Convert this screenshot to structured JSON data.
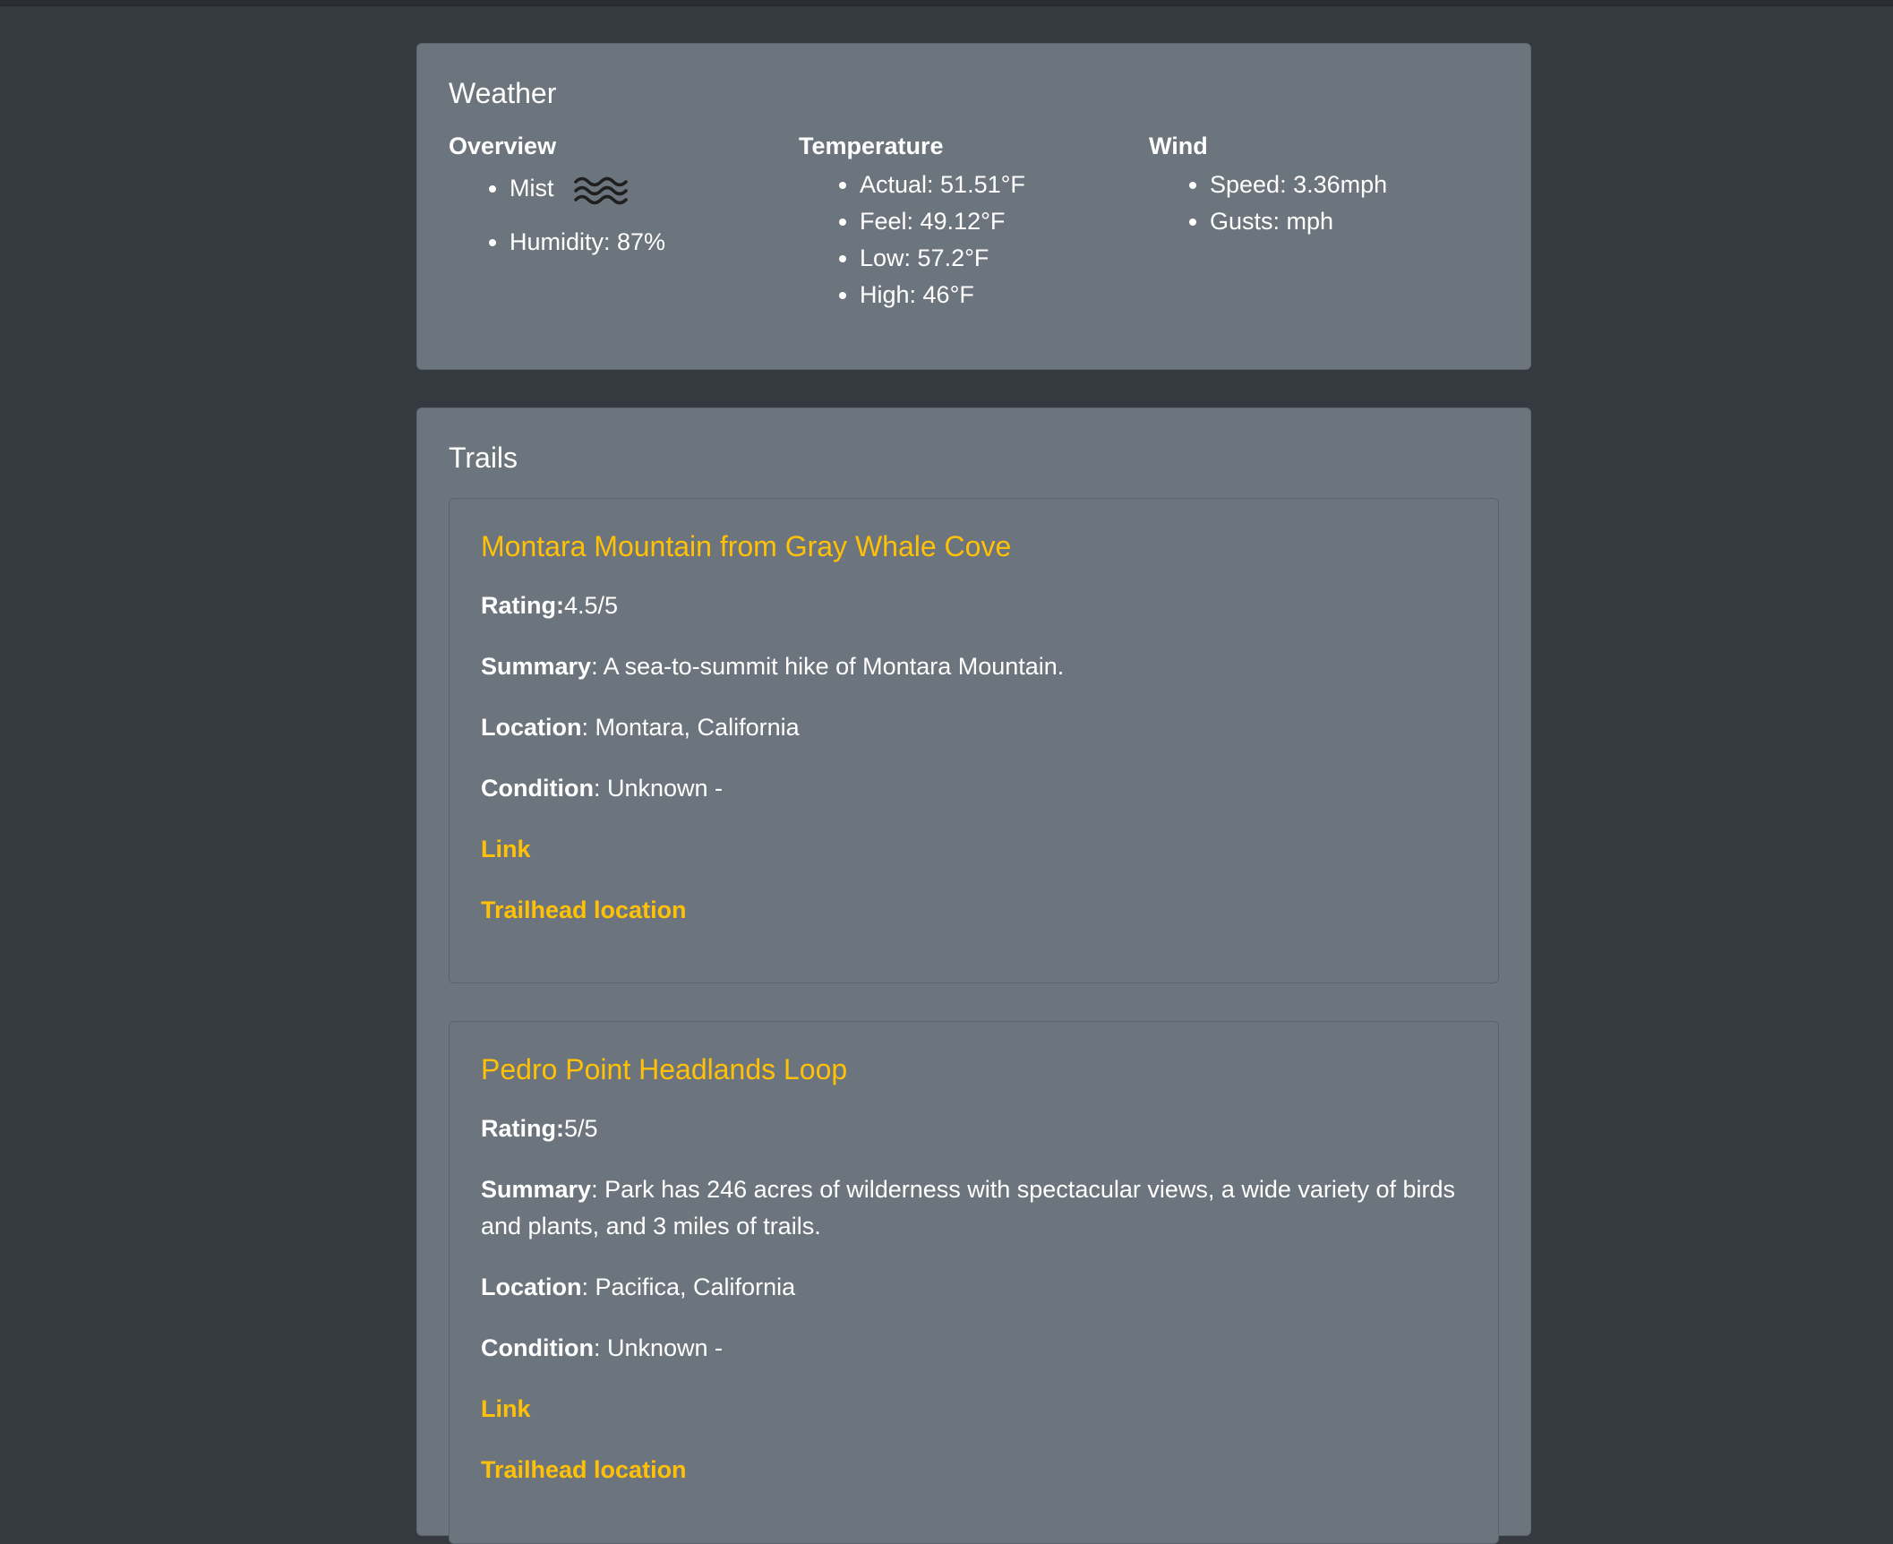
{
  "weather": {
    "title": "Weather",
    "overview": {
      "heading": "Overview",
      "condition": "Mist",
      "condition_icon": "mist-icon",
      "humidity": "Humidity: 87%"
    },
    "temperature": {
      "heading": "Temperature",
      "items": [
        "Actual: 51.51°F",
        "Feel: 49.12°F",
        "Low: 57.2°F",
        "High: 46°F"
      ]
    },
    "wind": {
      "heading": "Wind",
      "items": [
        "Speed: 3.36mph",
        "Gusts: mph"
      ]
    }
  },
  "trails": {
    "title": "Trails",
    "items": [
      {
        "name": "Montara Mountain from Gray Whale Cove",
        "rating_label": "Rating:",
        "rating": "4.5/5",
        "summary_label": "Summary",
        "summary": ": A sea-to-summit hike of Montara Mountain.",
        "location_label": "Location",
        "location": ": Montara, California",
        "condition_label": "Condition",
        "condition": ": Unknown -",
        "link_label": "Link",
        "trailhead_label": "Trailhead location"
      },
      {
        "name": "Pedro Point Headlands Loop",
        "rating_label": "Rating:",
        "rating": "5/5",
        "summary_label": "Summary",
        "summary": ": Park has 246 acres of wilderness with spectacular views, a wide variety of birds and plants, and 3 miles of trails.",
        "location_label": "Location",
        "location": ": Pacifica, California",
        "condition_label": "Condition",
        "condition": ": Unknown -",
        "link_label": "Link",
        "trailhead_label": "Trailhead location"
      }
    ]
  },
  "colors": {
    "background": "#343a40",
    "card": "#6c757d",
    "accent": "#ffc107"
  }
}
